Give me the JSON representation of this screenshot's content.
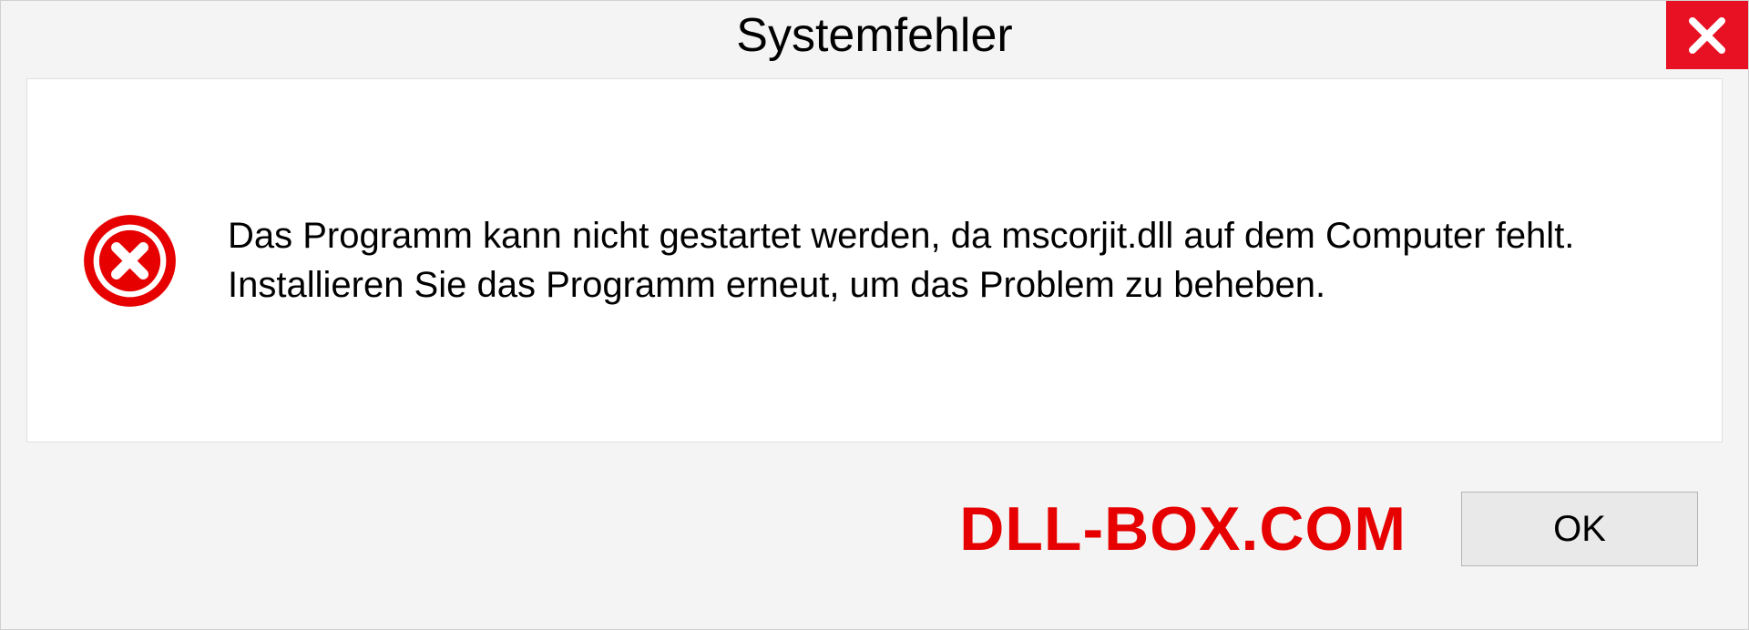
{
  "dialog": {
    "title": "Systemfehler",
    "message": "Das Programm kann nicht gestartet werden, da mscorjit.dll auf dem Computer fehlt. Installieren Sie das Programm erneut, um das Problem zu beheben.",
    "ok_label": "OK"
  },
  "watermark": "DLL-BOX.COM"
}
